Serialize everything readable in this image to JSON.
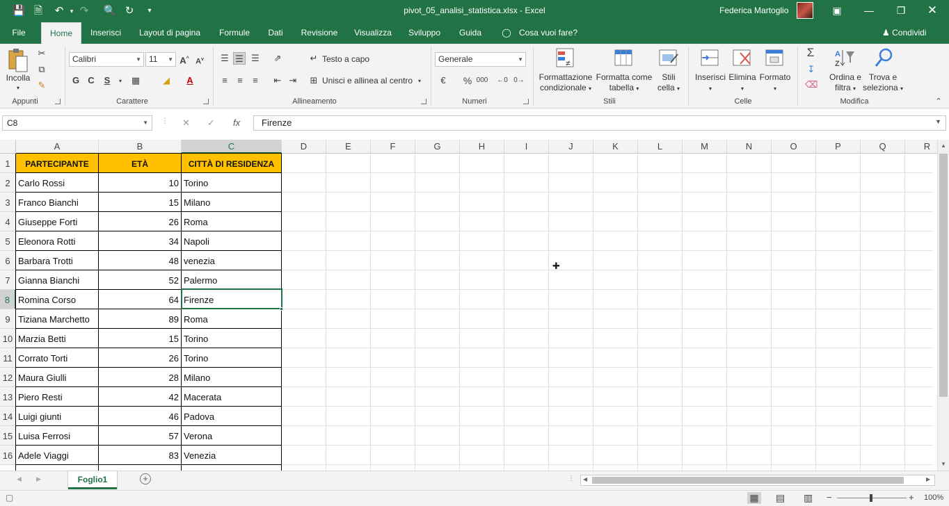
{
  "titlebar": {
    "filename": "pivot_05_analisi_statistica.xlsx  -  Excel",
    "user": "Federica Martoglio"
  },
  "tabs": [
    "File",
    "Home",
    "Inserisci",
    "Layout di pagina",
    "Formule",
    "Dati",
    "Revisione",
    "Visualizza",
    "Sviluppo",
    "Guida"
  ],
  "tell_me": "Cosa vuoi fare?",
  "share": "Condividi",
  "ribbon": {
    "appunti": {
      "label": "Appunti",
      "paste": "Incolla"
    },
    "carattere": {
      "label": "Carattere",
      "font": "Calibri",
      "size": "11",
      "bold": "G",
      "italic": "C",
      "underline": "S"
    },
    "allineamento": {
      "label": "Allineamento",
      "wrap": "Testo a capo",
      "merge": "Unisci e allinea al centro"
    },
    "numeri": {
      "label": "Numeri",
      "format": "Generale",
      "percent": "%",
      "thousands": "000"
    },
    "stili": {
      "label": "Stili",
      "cond1": "Formattazione",
      "cond2": "condizionale",
      "table1": "Formatta come",
      "table2": "tabella",
      "styles1": "Stili",
      "styles2": "cella"
    },
    "celle": {
      "label": "Celle",
      "insert": "Inserisci",
      "delete": "Elimina",
      "format": "Formato"
    },
    "modifica": {
      "label": "Modifica",
      "sort1": "Ordina e",
      "sort2": "filtra",
      "find1": "Trova e",
      "find2": "seleziona"
    }
  },
  "formula_bar": {
    "namebox": "C8",
    "fx": "fx",
    "value": "Firenze"
  },
  "columns": [
    "A",
    "B",
    "C",
    "D",
    "E",
    "F",
    "G",
    "H",
    "I",
    "J",
    "K",
    "L",
    "M",
    "N",
    "O",
    "P",
    "Q",
    "R"
  ],
  "rows": [
    "1",
    "2",
    "3",
    "4",
    "5",
    "6",
    "7",
    "8",
    "9",
    "10",
    "11",
    "12",
    "13",
    "14",
    "15",
    "16"
  ],
  "table": {
    "headers": [
      "PARTECIPANTE",
      "ETÀ",
      "CITTÀ DI RESIDENZA"
    ],
    "rows": [
      [
        "Carlo Rossi",
        "10",
        "Torino"
      ],
      [
        "Franco Bianchi",
        "15",
        "Milano"
      ],
      [
        "Giuseppe Forti",
        "26",
        "Roma"
      ],
      [
        "Eleonora Rotti",
        "34",
        "Napoli"
      ],
      [
        "Barbara Trotti",
        "48",
        "venezia"
      ],
      [
        "Gianna Bianchi",
        "52",
        "Palermo"
      ],
      [
        "Romina Corso",
        "64",
        "Firenze"
      ],
      [
        "Tiziana Marchetto",
        "89",
        "Roma"
      ],
      [
        "Marzia Betti",
        "15",
        "Torino"
      ],
      [
        "Corrato Torti",
        "26",
        "Torino"
      ],
      [
        "Maura Giulli",
        "28",
        "Milano"
      ],
      [
        "Piero Resti",
        "42",
        "Macerata"
      ],
      [
        "Luigi giunti",
        "46",
        "Padova"
      ],
      [
        "Luisa Ferrosi",
        "57",
        "Verona"
      ],
      [
        "Adele Viaggi",
        "83",
        "Venezia"
      ]
    ]
  },
  "sheet": {
    "tab": "Foglio1"
  },
  "status": {
    "zoom": "100%"
  },
  "colors": {
    "accent": "#217346",
    "header_fill": "#ffc000"
  }
}
